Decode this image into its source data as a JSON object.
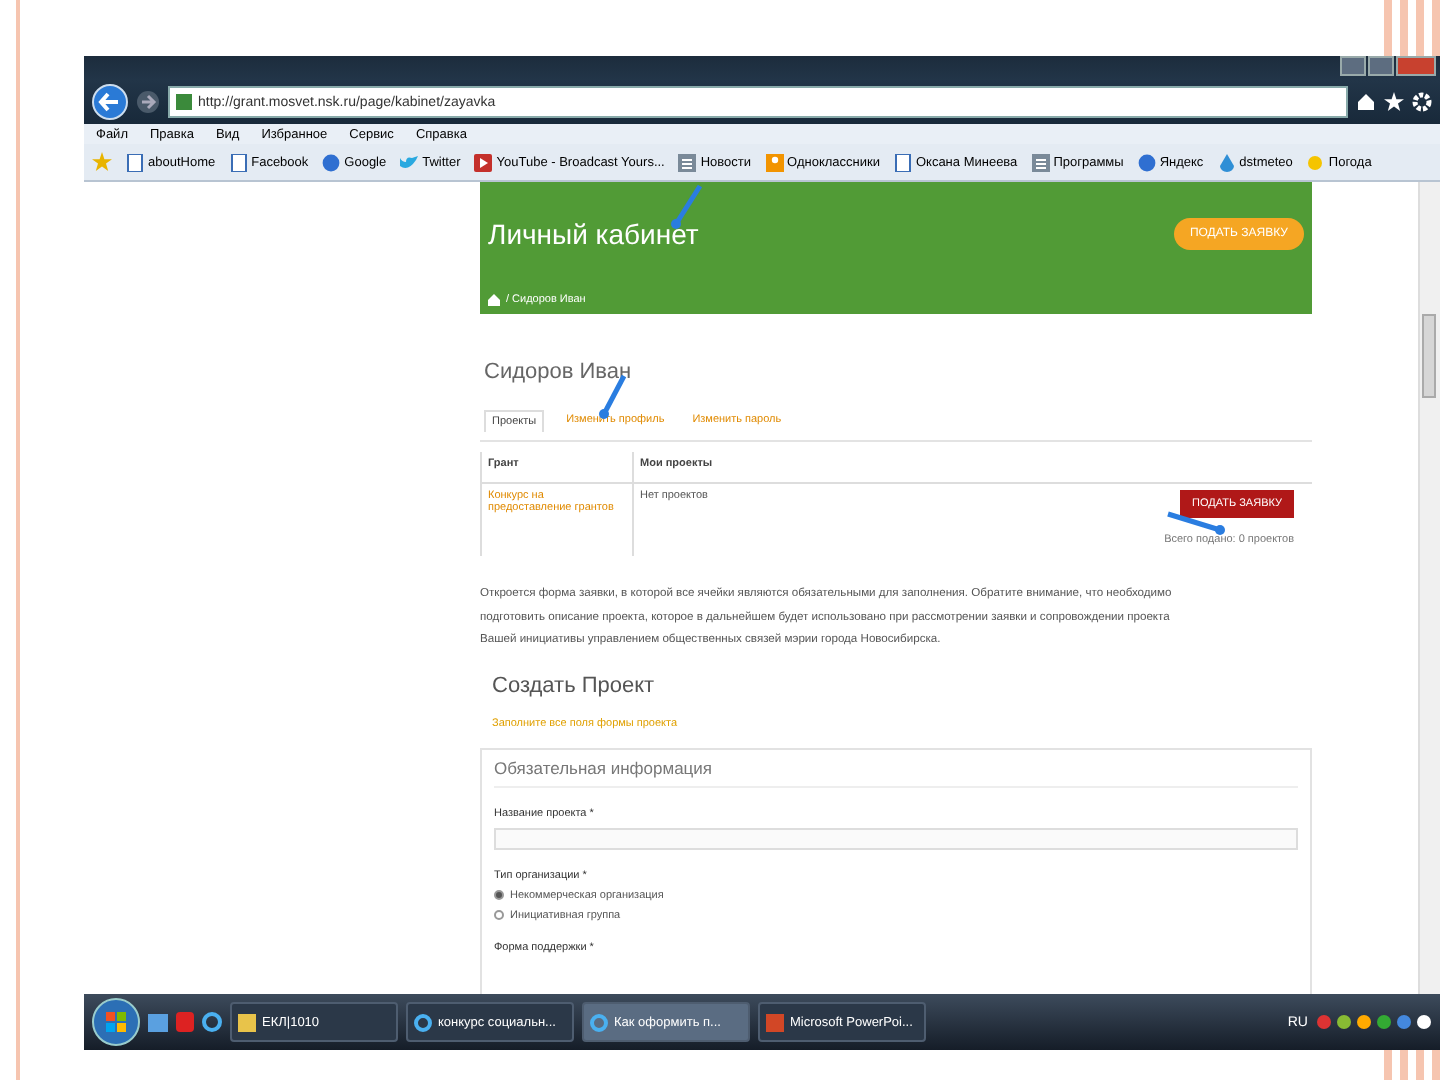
{
  "browser": {
    "address": "http://grant.mosvet.nsk.ru/page/kabinet/zayavka",
    "menu": [
      "Файл",
      "Правка",
      "Вид",
      "Избранное",
      "Сервис",
      "Справка"
    ],
    "favorites": [
      {
        "label": "aboutHome",
        "kind": "page"
      },
      {
        "label": "Facebook",
        "kind": "page"
      },
      {
        "label": "Google",
        "kind": "search"
      },
      {
        "label": "Twitter",
        "kind": "bird"
      },
      {
        "label": "YouTube - Broadcast Yours...",
        "kind": "video"
      },
      {
        "label": "Новости",
        "kind": "news"
      },
      {
        "label": "Одноклассники",
        "kind": "social"
      },
      {
        "label": "Оксана Минеева",
        "kind": "page"
      },
      {
        "label": "Программы",
        "kind": "news"
      },
      {
        "label": "Яндекс",
        "kind": "search"
      },
      {
        "label": "dstmeteo",
        "kind": "drop"
      },
      {
        "label": "Погода",
        "kind": "sun"
      }
    ]
  },
  "page": {
    "header": {
      "title": "Личный кабинет",
      "button": "ПОДАТЬ ЗАЯВКУ",
      "breadcrumb": "/ Сидоров Иван"
    },
    "user_name": "Сидоров Иван",
    "tabs": [
      {
        "label": "Проекты",
        "selected": true
      },
      {
        "label": "Изменить профиль",
        "selected": false
      },
      {
        "label": "Изменить пароль",
        "selected": false
      }
    ],
    "table": {
      "columns": [
        "Грант",
        "Мои проекты"
      ],
      "grant_link": "Конкурс на предоставление грантов",
      "projects_text": "Нет проектов",
      "submit_button": "ПОДАТЬ ЗАЯВКУ",
      "total": "Всего подано: 0 проектов"
    },
    "instructions": [
      "Откроется форма заявки, в которой все ячейки являются обязательными для заполнения. Обратите внимание, что необходимо",
      "подготовить описание проекта, которое в дальнейшем будет использовано при рассмотрении заявки и сопровождении проекта",
      "Вашей инициативы управлением общественных связей мэрии города Новосибирска."
    ],
    "create": {
      "title": "Создать Проект",
      "link": "Заполните все поля формы проекта",
      "card": {
        "title": "Обязательная информация",
        "fields": [
          {
            "kind": "text",
            "label": "Название проекта *"
          },
          {
            "kind": "radio",
            "label": "Тип организации *",
            "options": [
              {
                "label": "Некоммерческая организация",
                "selected": true
              },
              {
                "label": "Инициативная группа",
                "selected": false
              }
            ]
          },
          {
            "kind": "label",
            "label": "Форма поддержки *"
          }
        ]
      }
    }
  },
  "taskbar": {
    "items": [
      {
        "label": "ЕКЛ|1010",
        "kind": "folder",
        "selected": false
      },
      {
        "label": "конкурс социальн...",
        "kind": "browser",
        "selected": false
      },
      {
        "label": "Как оформить п...",
        "kind": "browser",
        "selected": true
      },
      {
        "label": "Microsoft PowerPoi...",
        "kind": "presentation",
        "selected": false
      }
    ],
    "language": "RU"
  }
}
